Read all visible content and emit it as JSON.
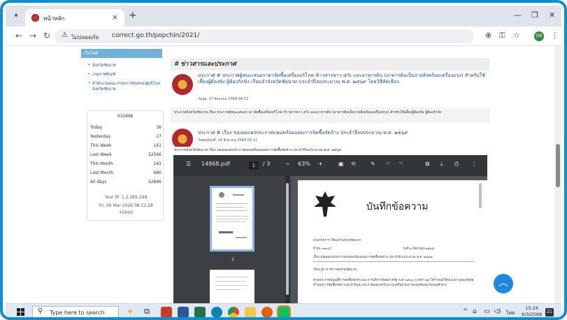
{
  "browser": {
    "tab_title": "หน้าหลัก",
    "tab_close": "×",
    "new_tab": "+",
    "security_label": "ไม่ปลอดภัย",
    "url": "correct.go.th/popchin/2021/",
    "window_minimize": "—",
    "window_maximize": "❐",
    "window_close": "✕",
    "profile_initials": "ON"
  },
  "sidebar": {
    "heading": "เว็บไซต์",
    "links": [
      "จังหวัดชัยนาท",
      "กรมราชทัณฑ์",
      "สำนักงานคณะกรรมการคุ้มครองผู้บริโภคจังหวัดชัยนาท"
    ],
    "counter": "032896",
    "stats": [
      {
        "label": "Today",
        "value": "36"
      },
      {
        "label": "Yesterday",
        "value": "27"
      },
      {
        "label": "This Week",
        "value": "161"
      },
      {
        "label": "Last Week",
        "value": "32566"
      },
      {
        "label": "This Month",
        "value": "161"
      },
      {
        "label": "Last Month",
        "value": "680"
      },
      {
        "label": "All days",
        "value": "32896"
      }
    ],
    "ip": "Your IP: 1.2.165.248",
    "datetime_line1": "Fri, 06 Mar 2026 08:22:28",
    "datetime_line2": "+0000"
  },
  "news": {
    "heading": "# ข่าวสารและประกาศ",
    "items": [
      {
        "title": "ประกาศ # ประกาศผู้ชนะเสนอราคาจัดซื้อเครื่องบริโภค ข้าวสารขาว ๕% และอาหารดิบ (อาหารดิบเป็นรายสิ่งพร้อมเครื่องปรุง) สำหรับใช้เลี้ยงผู้ต้องขัง ผู้ต้องกักขัง เรือนจำจังหวัดชัยนาท ประจำปีงบประมาณ พ.ศ. ๒๕๖๙ โดยวิธีคัดเลือก",
        "date": "วันพุธ, 27 สิงหาคม 2568 04:51",
        "desc": "ประกาศจังหวัดชัยนาท เรื่อง ประกาศผู้ชนะเสนอราคาจัดซื้อเครื่องบริโภค ข้าวสารขาว ๕% และอาหารดิบ (อาหารดิบเป็นรายสิ่งพร้อมเครื่องปรุง) สำหรับใช้เลี้ยงผู้ต้องขัง ผู้ต้องกักขัง"
      },
      {
        "title": "ประกาศ # เรื่อง ขอเผยแพร่ประกาศแผนพร้อมแผนการจัดซื้อจัดจ้าง ประจำปีงบประมาณ พ.ศ. ๒๕๖๙",
        "date": "วันพฤหัสบดี, 14 สิงหาคม 2568 09:12",
        "desc": "ประกาศจังหวัดชัยนาท เรื่อง ขอเผยแพร่ประกาศแผนพร้อมแผนการจัดซื้อจัดจ้าง ประจำปีงบประมาณ พ.ศ. ๒๕๖๙"
      }
    ]
  },
  "pdf": {
    "filename": "14868.pdf",
    "page_current": "1",
    "page_total": "/ 3",
    "zoom": "63%",
    "thumb_page_label": "1",
    "doc_title": "บันทึกข้อความ",
    "doc_fields": [
      "ส่วนราชการ  เรือนจำจังหวัดชัยนาท",
      "ที่  ชน ๐๗๐๔/",
      "วันที่  ๒ สิงหาคม ๒๕๖๘",
      "เรื่อง  ขอเผยแพร่ประกาศแผนพร้อมแผนการจัดซื้อจัดจ้าง ประจำปีงบประมาณ พ.ศ. ๒๕๖๙",
      "เรียน  ผู้ว่าราชการจังหวัดชัยนาท"
    ],
    "doc_body": "ตามพระราชบัญญัติการจัดซื้อจัดจ้างและการบริหารพัสดุภาครัฐ พ.ศ. ๒๕๖๐ มาตรา ๑๑ ได้กำหนดให้หน่วยงานของรัฐจัดทำแผนการจัดซื้อจัดจ้างประจำปีและประกาศเผยแพร่ในระบบเครือข่ายสารสนเทศของกรมบัญชีกลาง"
  },
  "taskbar": {
    "search_placeholder": "Type here to search",
    "language": "ไทย",
    "time": "15:24",
    "date": "6/3/2569",
    "notification_count": "21"
  }
}
